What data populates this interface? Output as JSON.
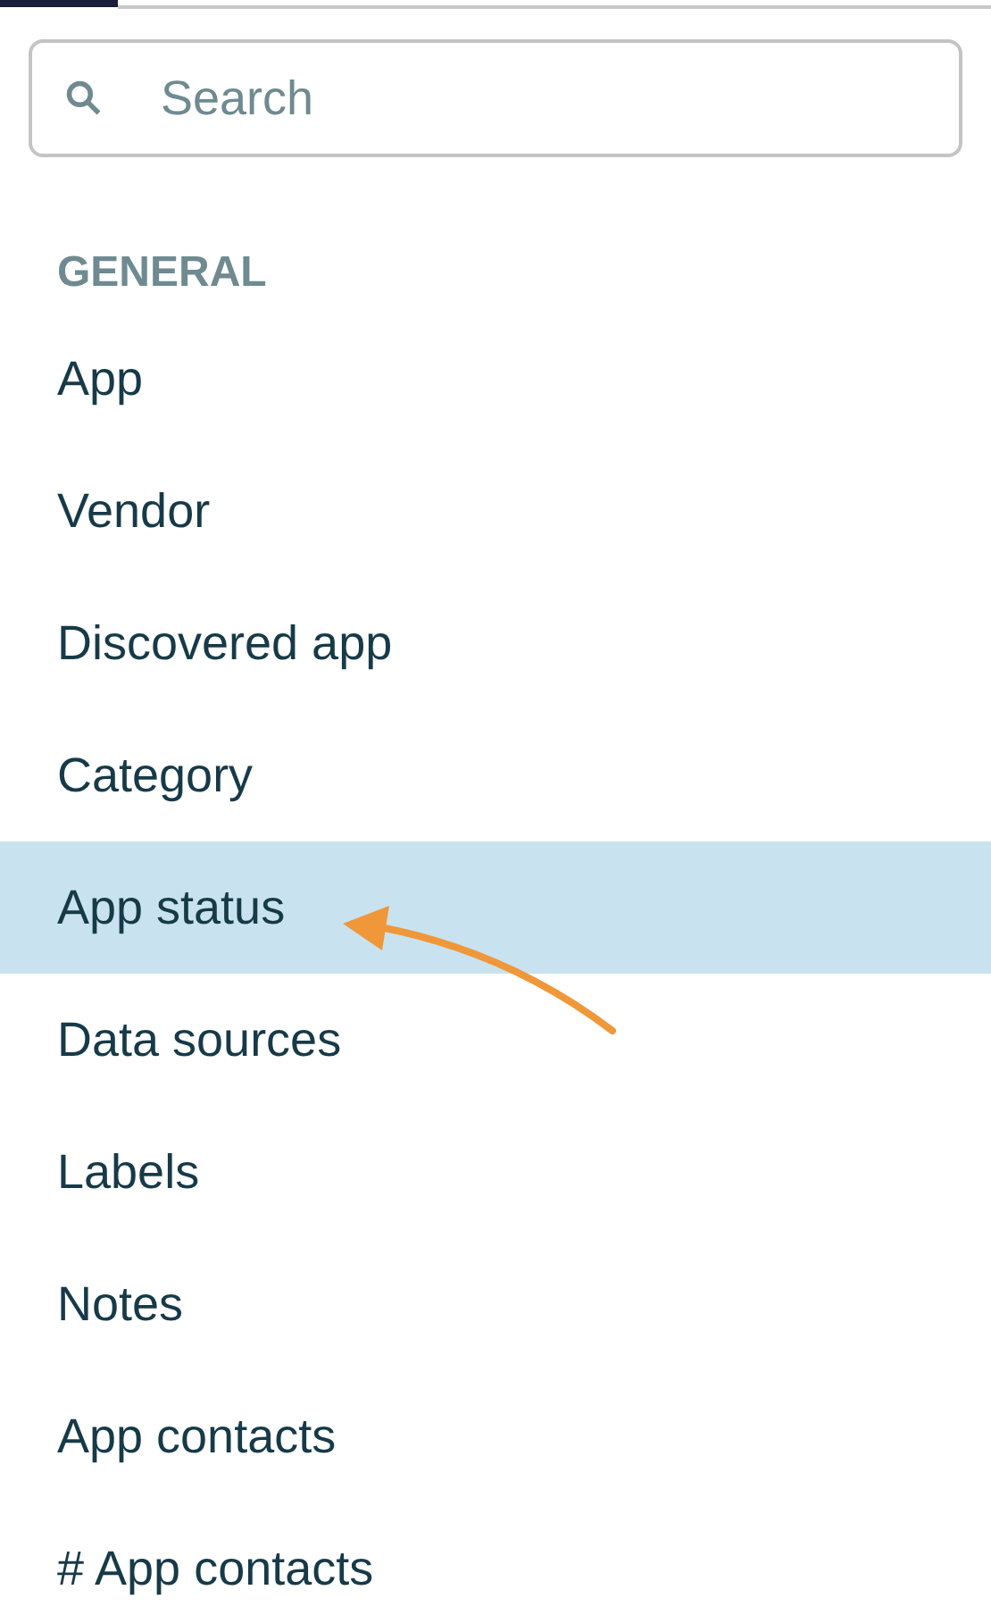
{
  "search": {
    "placeholder": "Search"
  },
  "section": {
    "title": "GENERAL"
  },
  "items": [
    {
      "label": "App",
      "selected": false
    },
    {
      "label": "Vendor",
      "selected": false
    },
    {
      "label": "Discovered app",
      "selected": false
    },
    {
      "label": "Category",
      "selected": false
    },
    {
      "label": "App status",
      "selected": true
    },
    {
      "label": "Data sources",
      "selected": false
    },
    {
      "label": "Labels",
      "selected": false
    },
    {
      "label": "Notes",
      "selected": false
    },
    {
      "label": "App contacts",
      "selected": false
    },
    {
      "label": "# App contacts",
      "selected": false
    }
  ]
}
